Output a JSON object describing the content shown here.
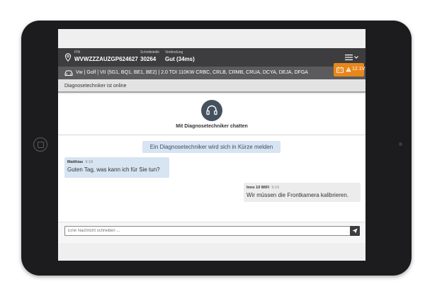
{
  "header": {
    "fin_label": "FIN",
    "fin_value": "WVWZZZAUZGP624627",
    "schnittstelle_label": "Schnittstelle",
    "schnittstelle_value": "30264",
    "verbindung_label": "Verbindung",
    "verbindung_value": "Gut (34ms)",
    "menu_icon": "hamburger-menu-icon"
  },
  "vehicle": {
    "description": "Vw | Golf | VII (5G1, BQ1, BE1, BE2) | 2.0 TDI 110KW CRBC, CRLB, CRMB, CRUA, DCYA, DEJA, DFGA",
    "battery": "12.1V",
    "battery_color": "#e8861b"
  },
  "status": {
    "text": "Diagnosetechniker ist online"
  },
  "chat": {
    "title": "Mit Diagnosetechniker chatten",
    "system_message": "Ein Diagnosetechniker wird sich in Kürze melden",
    "messages": [
      {
        "sender": "Matthias",
        "time": "9:18",
        "text": "Guten Tag, was kann ich für Sie tun?"
      },
      {
        "sender": "Inno 10 WiFi",
        "time": "9:19",
        "text": "Wir müssen die Frontkamera kalibrieren."
      }
    ]
  },
  "input": {
    "placeholder": "Eine Nachricht schreiben ..."
  }
}
